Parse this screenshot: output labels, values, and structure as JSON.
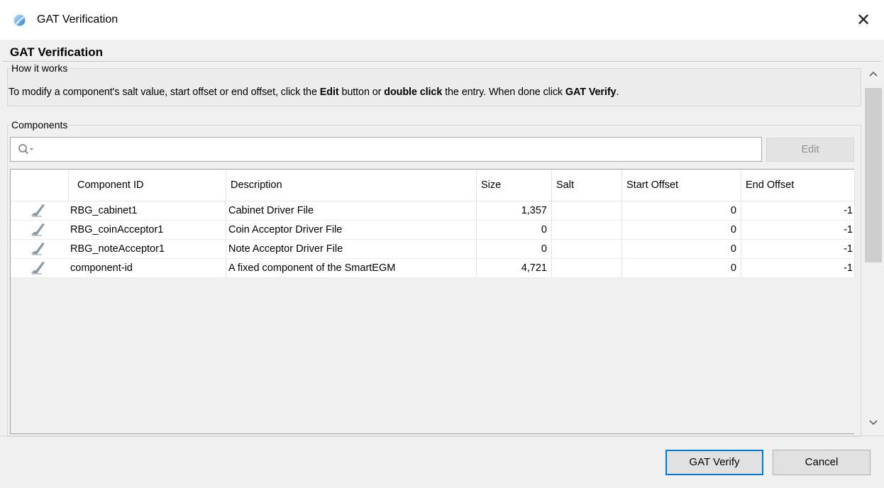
{
  "window": {
    "title": "GAT Verification",
    "close_glyph": "✕",
    "icon": "app-icon"
  },
  "dialog": {
    "heading": "GAT Verification"
  },
  "how_it_works": {
    "label": "How it works",
    "text_parts": [
      "To modify a component's salt value, start offset or end offset, click the ",
      "Edit",
      " button or ",
      "double click",
      " the entry. When done click ",
      "GAT Verify",
      "."
    ]
  },
  "components": {
    "label": "Components",
    "search": {
      "value": "",
      "placeholder": "",
      "icon": "search-icon"
    },
    "edit_button": "Edit",
    "columns": [
      "",
      "Component ID",
      "Description",
      "Size",
      "Salt",
      "Start Offset",
      "End Offset"
    ],
    "rows": [
      {
        "icon": "check-icon",
        "id": "RBG_cabinet1",
        "description": "Cabinet Driver File",
        "size": "1,357",
        "salt": "",
        "start_offset": "0",
        "end_offset": "-1"
      },
      {
        "icon": "check-icon",
        "id": "RBG_coinAcceptor1",
        "description": "Coin Acceptor Driver File",
        "size": "0",
        "salt": "",
        "start_offset": "0",
        "end_offset": "-1"
      },
      {
        "icon": "check-icon",
        "id": "RBG_noteAcceptor1",
        "description": "Note Acceptor Driver File",
        "size": "0",
        "salt": "",
        "start_offset": "0",
        "end_offset": "-1"
      },
      {
        "icon": "check-icon",
        "id": "component-id",
        "description": "A fixed component of the SmartEGM",
        "size": "4,721",
        "salt": "",
        "start_offset": "0",
        "end_offset": "-1"
      }
    ]
  },
  "buttons": {
    "gat_verify": "GAT Verify",
    "cancel": "Cancel"
  },
  "colors": {
    "accent": "#0078d7",
    "window_bg": "#f0f0f0",
    "titlebar_bg": "#ffffff"
  }
}
